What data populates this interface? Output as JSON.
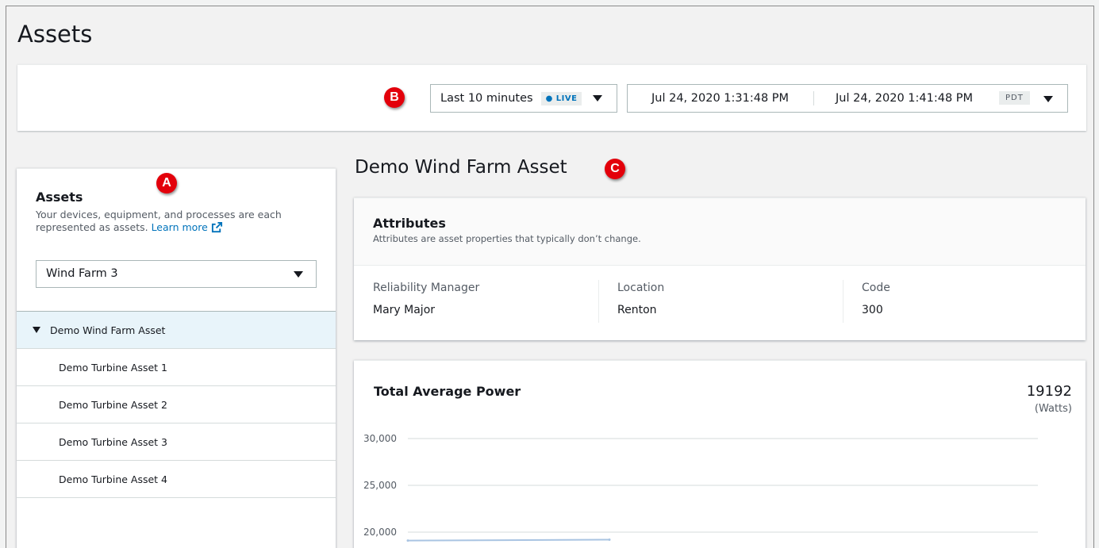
{
  "page": {
    "title": "Assets"
  },
  "timebar": {
    "relative_label": "Last 10 minutes",
    "live_badge": "LIVE",
    "range_start": "Jul 24, 2020 1:31:48 PM",
    "range_end": "Jul 24, 2020 1:41:48 PM",
    "timezone": "PDT"
  },
  "markers": {
    "a": "A",
    "b": "B",
    "c": "C"
  },
  "sidebar": {
    "title": "Assets",
    "description": "Your devices, equipment, and processes are each represented as assets.",
    "learn_more": "Learn more",
    "selected_farm": "Wind Farm 3",
    "tree": {
      "root": "Demo Wind Farm Asset",
      "children": [
        "Demo Turbine Asset 1",
        "Demo Turbine Asset 2",
        "Demo Turbine Asset 3",
        "Demo Turbine Asset 4"
      ]
    }
  },
  "asset": {
    "title": "Demo Wind Farm Asset",
    "attributes": {
      "title": "Attributes",
      "subtitle": "Attributes are asset properties that typically don’t change.",
      "items": [
        {
          "key": "Reliability Manager",
          "value": "Mary Major"
        },
        {
          "key": "Location",
          "value": "Renton"
        },
        {
          "key": "Code",
          "value": "300"
        }
      ]
    },
    "power": {
      "title": "Total Average Power",
      "value": "19192",
      "unit": "(Watts)"
    }
  },
  "chart_data": {
    "type": "line",
    "title": "Total Average Power",
    "y_ticks": [
      "30,000",
      "25,000",
      "20,000"
    ],
    "y_tick_values": [
      30000,
      25000,
      20000
    ],
    "ylim": [
      20000,
      30000
    ],
    "grid": true,
    "series": [
      {
        "values": [
          19100,
          19192
        ]
      }
    ],
    "line_color": "#a9c4e2"
  }
}
